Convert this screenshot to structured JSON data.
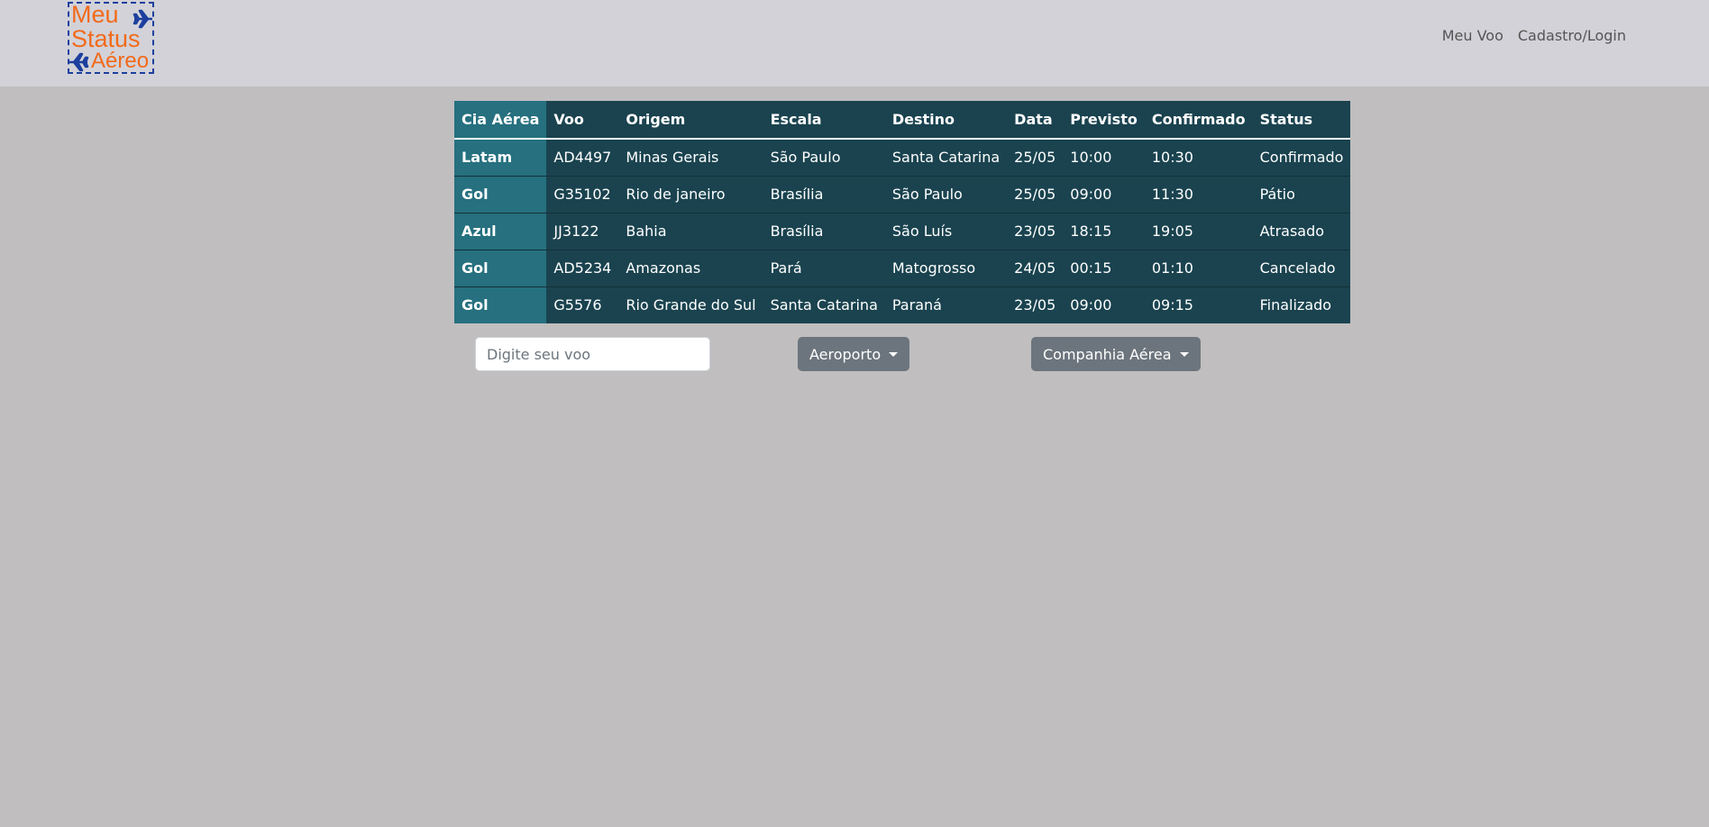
{
  "brand": {
    "line1": "Meu",
    "line2": "Status",
    "line3": "Aéreo",
    "icon": "airplane-icon",
    "text_color": "#f26a1b",
    "border_color": "#1d3f9e"
  },
  "nav": {
    "links": [
      "Meu Voo",
      "Cadastro/Login"
    ]
  },
  "table": {
    "headers": [
      "Cia Aérea",
      "Voo",
      "Origem",
      "Escala",
      "Destino",
      "Data",
      "Previsto",
      "Confirmado",
      "Status"
    ],
    "rows": [
      [
        "Latam",
        "AD4497",
        "Minas Gerais",
        "São Paulo",
        "Santa Catarina",
        "25/05",
        "10:00",
        "10:30",
        "Confirmado"
      ],
      [
        "Gol",
        "G35102",
        "Rio de janeiro",
        "Brasília",
        "São Paulo",
        "25/05",
        "09:00",
        "11:30",
        "Pátio"
      ],
      [
        "Azul",
        "JJ3122",
        "Bahia",
        "Brasília",
        "São Luís",
        "23/05",
        "18:15",
        "19:05",
        "Atrasado"
      ],
      [
        "Gol",
        "AD5234",
        "Amazonas",
        "Pará",
        "Matogrosso",
        "24/05",
        "00:15",
        "01:10",
        "Cancelado"
      ],
      [
        "Gol",
        "G5576",
        "Rio Grande do Sul",
        "Santa Catarina",
        "Paraná",
        "23/05",
        "09:00",
        "09:15",
        "Finalizado"
      ]
    ]
  },
  "filters": {
    "search_placeholder": "Digite seu voo",
    "search_value": "",
    "airport_label": "Aeroporto",
    "airline_label": "Companhia Aérea"
  },
  "colors": {
    "table_bg": "#1a434f",
    "airline_col_bg": "#26707f",
    "page_bg": "#c0bebf",
    "navbar_bg": "#d2d2d8",
    "button_bg": "#6c757d"
  }
}
